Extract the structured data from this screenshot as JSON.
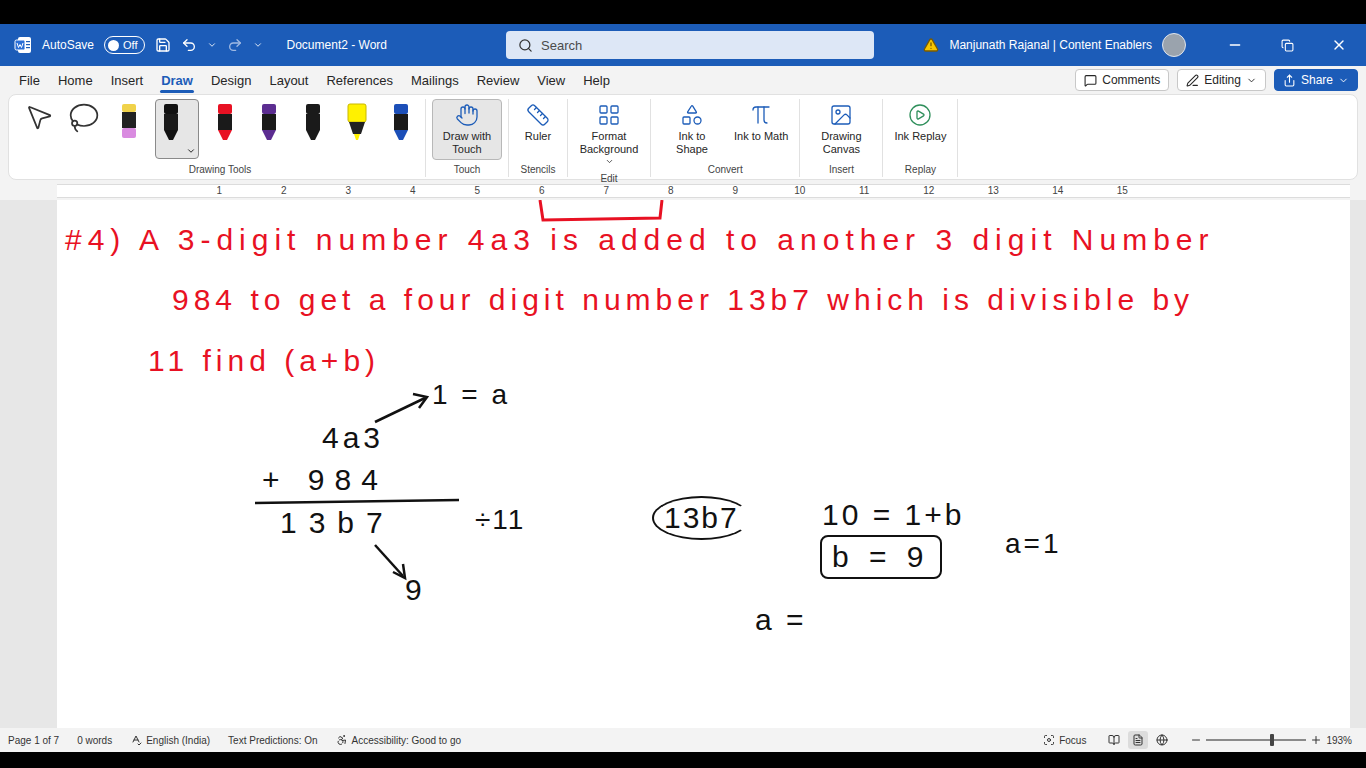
{
  "window": {
    "autosave_label": "AutoSave",
    "autosave_state": "Off",
    "autosave_on": false,
    "title": "Document2 - Word",
    "search_placeholder": "Search",
    "user": "Manjunath Rajanal | Content Enablers"
  },
  "menu_tabs": [
    {
      "label": "File",
      "selected": false
    },
    {
      "label": "Home",
      "selected": false
    },
    {
      "label": "Insert",
      "selected": false
    },
    {
      "label": "Draw",
      "selected": true
    },
    {
      "label": "Design",
      "selected": false
    },
    {
      "label": "Layout",
      "selected": false
    },
    {
      "label": "References",
      "selected": false
    },
    {
      "label": "Mailings",
      "selected": false
    },
    {
      "label": "Review",
      "selected": false
    },
    {
      "label": "View",
      "selected": false
    },
    {
      "label": "Help",
      "selected": false
    }
  ],
  "right_buttons": [
    {
      "kind": "comments",
      "label": "Comments"
    },
    {
      "kind": "editing",
      "label": "Editing"
    },
    {
      "kind": "share",
      "label": "Share"
    }
  ],
  "drawing_tools": {
    "label": "Drawing Tools",
    "tools": [
      {
        "kind": "select",
        "selected": false
      },
      {
        "kind": "lasso",
        "selected": false
      },
      {
        "kind": "pencil",
        "color": "#d98be0",
        "selected": false
      },
      {
        "kind": "pen",
        "color": "#111111",
        "selected": true
      },
      {
        "kind": "pen",
        "color": "#e81123",
        "selected": false
      },
      {
        "kind": "pen",
        "color": "#5c2d91",
        "selected": false
      },
      {
        "kind": "pen",
        "color": "#1a1a1a",
        "selected": false
      },
      {
        "kind": "highlighter",
        "color": "#fff100",
        "selected": false
      },
      {
        "kind": "pen",
        "color": "#1c4fb8",
        "selected": false
      }
    ]
  },
  "ribbon_groups": [
    {
      "label": "Touch",
      "buttons": [
        {
          "kind": "touch",
          "label": "Draw with Touch",
          "dropdown": false,
          "selected": true
        }
      ]
    },
    {
      "label": "Stencils",
      "buttons": [
        {
          "kind": "ruler",
          "label": "Ruler",
          "dropdown": false,
          "selected": false
        }
      ]
    },
    {
      "label": "Edit",
      "buttons": [
        {
          "kind": "background",
          "label": "Format Background",
          "dropdown": true,
          "selected": false
        }
      ]
    },
    {
      "label": "Convert",
      "buttons": [
        {
          "kind": "shape",
          "label": "Ink to Shape",
          "dropdown": false,
          "selected": false
        },
        {
          "kind": "math",
          "label": "Ink to Math",
          "dropdown": false,
          "selected": false
        }
      ]
    },
    {
      "label": "Insert",
      "buttons": [
        {
          "kind": "canvas",
          "label": "Drawing Canvas",
          "dropdown": false,
          "selected": false
        }
      ]
    },
    {
      "label": "Replay",
      "buttons": [
        {
          "kind": "replay",
          "label": "Ink Replay",
          "dropdown": false,
          "selected": false
        }
      ]
    }
  ],
  "ruler": [
    "1",
    "2",
    "3",
    "4",
    "5",
    "6",
    "7",
    "8",
    "9",
    "10",
    "11",
    "12",
    "13",
    "14",
    "15"
  ],
  "ink": [
    {
      "text": "#4) A 3-digit number 4a3 is added to another 3 digit Number",
      "kind": "plain",
      "color": "#e81123"
    },
    {
      "text": "984 to get a four digit number 13b7 which is divisible by",
      "kind": "plain",
      "color": "#e81123"
    },
    {
      "text": "11 find (a+b)",
      "kind": "plain",
      "color": "#e81123"
    },
    {
      "text": "1 = a",
      "kind": "plain",
      "color": "#111111"
    },
    {
      "text": "4a3",
      "kind": "plain",
      "color": "#111111"
    },
    {
      "text": "+ 984",
      "kind": "plain",
      "color": "#111111"
    },
    {
      "text": "13b7",
      "kind": "plain",
      "color": "#111111"
    },
    {
      "text": "÷11",
      "kind": "plain",
      "color": "#111111"
    },
    {
      "text": "9",
      "kind": "plain",
      "color": "#111111"
    },
    {
      "text": "13b7",
      "kind": "circled",
      "color": "#111111"
    },
    {
      "text": "10 = 1+b",
      "kind": "plain",
      "color": "#111111"
    },
    {
      "text": "b = 9",
      "kind": "boxed",
      "color": "#111111"
    },
    {
      "text": "a=1",
      "kind": "plain",
      "color": "#111111"
    },
    {
      "text": "a =",
      "kind": "plain",
      "color": "#111111"
    }
  ],
  "status_bar": {
    "page": "Page 1 of 7",
    "words": "0 words",
    "language": "English (India)",
    "predictions": "Text Predictions: On",
    "accessibility": "Accessibility: Good to go",
    "focus": "Focus",
    "view_modes": [
      {
        "kind": "read",
        "selected": false
      },
      {
        "kind": "print",
        "selected": true
      },
      {
        "kind": "web",
        "selected": false
      }
    ],
    "zoom": "193%",
    "zoom_level": 0.66
  }
}
